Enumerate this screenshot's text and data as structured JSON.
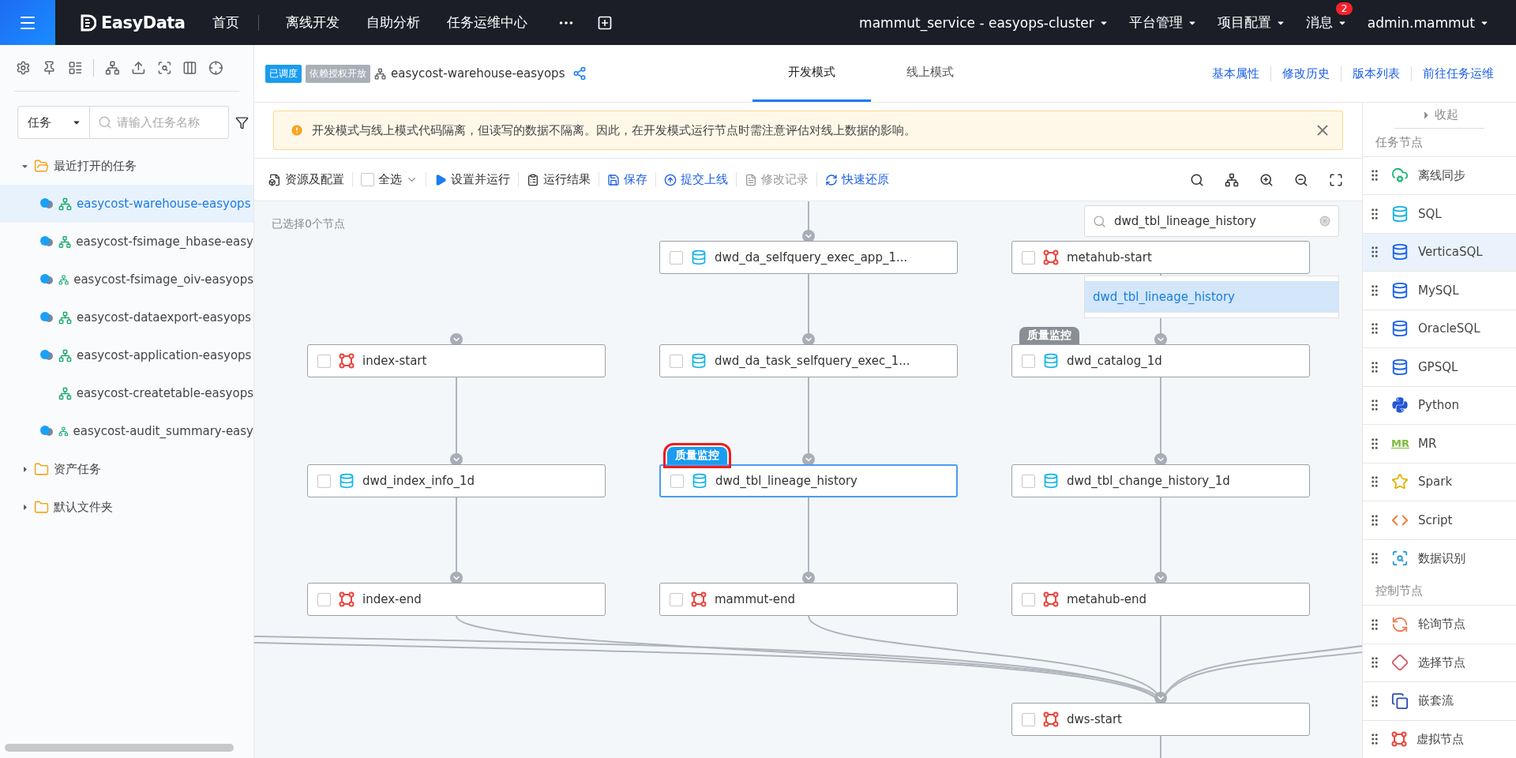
{
  "topbar": {
    "brand": "EasyData",
    "nav": [
      {
        "label": "首页",
        "selected": false
      },
      {
        "label": "离线开发",
        "selected": false
      },
      {
        "label": "自助分析",
        "selected": false
      },
      {
        "label": "任务运维中心",
        "selected": false
      }
    ],
    "menus": [
      {
        "label": "mammut_service - easyops-cluster"
      },
      {
        "label": "平台管理"
      },
      {
        "label": "项目配置"
      },
      {
        "label": "消息",
        "badge": "2"
      },
      {
        "label": "admin.mammut"
      }
    ]
  },
  "sidebar": {
    "filter": "任务",
    "search_placeholder": "请输入任务名称",
    "tree": [
      {
        "label": "最近打开的任务",
        "expanded": true,
        "children": [
          {
            "label": "easycost-warehouse-easyops",
            "shared": true,
            "selected": true
          },
          {
            "label": "easycost-fsimage_hbase-easy",
            "shared": true,
            "selected": false
          },
          {
            "label": "easycost-fsimage_oiv-easyops",
            "shared": true,
            "selected": false
          },
          {
            "label": "easycost-dataexport-easyops",
            "shared": true,
            "selected": false
          },
          {
            "label": "easycost-application-easyops",
            "shared": true,
            "selected": false
          },
          {
            "label": "easycost-createtable-easyops",
            "shared": false,
            "selected": false
          },
          {
            "label": "easycost-audit_summary-easy",
            "shared": true,
            "selected": false
          }
        ]
      },
      {
        "label": "资产任务",
        "expanded": false
      },
      {
        "label": "默认文件夹",
        "expanded": false
      }
    ]
  },
  "header": {
    "tags": [
      {
        "label": "已调度",
        "kind": "primary"
      },
      {
        "label": "依赖授权开放",
        "kind": "muted"
      }
    ],
    "flow_name": "easycost-warehouse-easyops",
    "modes": [
      {
        "label": "开发模式",
        "selected": true
      },
      {
        "label": "线上模式",
        "selected": false
      }
    ],
    "links": [
      "基本属性",
      "修改历史",
      "版本列表",
      "前往任务运维"
    ]
  },
  "alert": "开发模式与线上模式代码隔离，但读写的数据不隔离。因此，在开发模式运行节点时需注意评估对线上数据的影响。",
  "toolbar": [
    {
      "label": "资源及配置",
      "kind": "resource",
      "accent": false,
      "disabled": false
    },
    {
      "label": "全选",
      "kind": "checkbox",
      "checked": false,
      "accent": false,
      "disabled": false
    },
    {
      "label": "设置并运行",
      "kind": "run",
      "accent": false,
      "disabled": false
    },
    {
      "label": "运行结果",
      "kind": "result",
      "accent": false,
      "disabled": false
    },
    {
      "label": "保存",
      "kind": "save",
      "accent": true,
      "disabled": false
    },
    {
      "label": "提交上线",
      "kind": "submit",
      "accent": true,
      "disabled": false
    },
    {
      "label": "修改记录",
      "kind": "record",
      "accent": false,
      "disabled": true
    },
    {
      "label": "快速还原",
      "kind": "restore",
      "accent": true,
      "disabled": false
    }
  ],
  "canvas": {
    "selection": "已选择0个节点",
    "nodes": [
      {
        "name": "dwd_da_selfquery_exec_app_1...",
        "kind": "table",
        "checked": false,
        "selected": false
      },
      {
        "name": "metahub-start",
        "kind": "virtual",
        "checked": false,
        "selected": false
      },
      {
        "name": "index-start",
        "kind": "virtual",
        "checked": false,
        "selected": false
      },
      {
        "name": "dwd_da_task_selfquery_exec_1...",
        "kind": "table",
        "checked": false,
        "selected": false
      },
      {
        "name": "dwd_catalog_1d",
        "kind": "table",
        "checked": false,
        "selected": false,
        "tag": "质量监控",
        "tag_active": false
      },
      {
        "name": "dwd_index_info_1d",
        "kind": "table",
        "checked": false,
        "selected": false
      },
      {
        "name": "dwd_tbl_lineage_history",
        "kind": "table",
        "checked": false,
        "selected": true,
        "tag": "质量监控",
        "tag_active": true
      },
      {
        "name": "dwd_tbl_change_history_1d",
        "kind": "table",
        "checked": false,
        "selected": false
      },
      {
        "name": "index-end",
        "kind": "virtual",
        "checked": false,
        "selected": false
      },
      {
        "name": "mammut-end",
        "kind": "virtual",
        "checked": false,
        "selected": false
      },
      {
        "name": "metahub-end",
        "kind": "virtual",
        "checked": false,
        "selected": false
      },
      {
        "name": "dws-start",
        "kind": "virtual",
        "checked": false,
        "selected": false
      }
    ],
    "search": {
      "value": "dwd_tbl_lineage_history",
      "results": [
        {
          "label": "dwd_tbl_lineage_history",
          "selected": true
        }
      ]
    }
  },
  "palette": {
    "collapse": "收起",
    "sections": [
      {
        "title": "任务节点",
        "items": [
          {
            "label": "离线同步",
            "kind": "sync",
            "selected": false
          },
          {
            "label": "SQL",
            "kind": "sql",
            "selected": false
          },
          {
            "label": "VerticaSQL",
            "kind": "vertica",
            "selected": true
          },
          {
            "label": "MySQL",
            "kind": "mysql",
            "selected": false
          },
          {
            "label": "OracleSQL",
            "kind": "oracle",
            "selected": false
          },
          {
            "label": "GPSQL",
            "kind": "gp",
            "selected": false
          },
          {
            "label": "Python",
            "kind": "python",
            "selected": false
          },
          {
            "label": "MR",
            "kind": "mr",
            "logo": "MR",
            "selected": false
          },
          {
            "label": "Spark",
            "kind": "spark",
            "selected": false
          },
          {
            "label": "Script",
            "kind": "script",
            "selected": false
          },
          {
            "label": "数据识别",
            "kind": "detect",
            "selected": false
          }
        ]
      },
      {
        "title": "控制节点",
        "items": [
          {
            "label": "轮询节点",
            "kind": "poll",
            "selected": false
          },
          {
            "label": "选择节点",
            "kind": "choice",
            "selected": false
          },
          {
            "label": "嵌套流",
            "kind": "nested",
            "selected": false
          },
          {
            "label": "虚拟节点",
            "kind": "virtual",
            "selected": false
          }
        ]
      }
    ]
  }
}
